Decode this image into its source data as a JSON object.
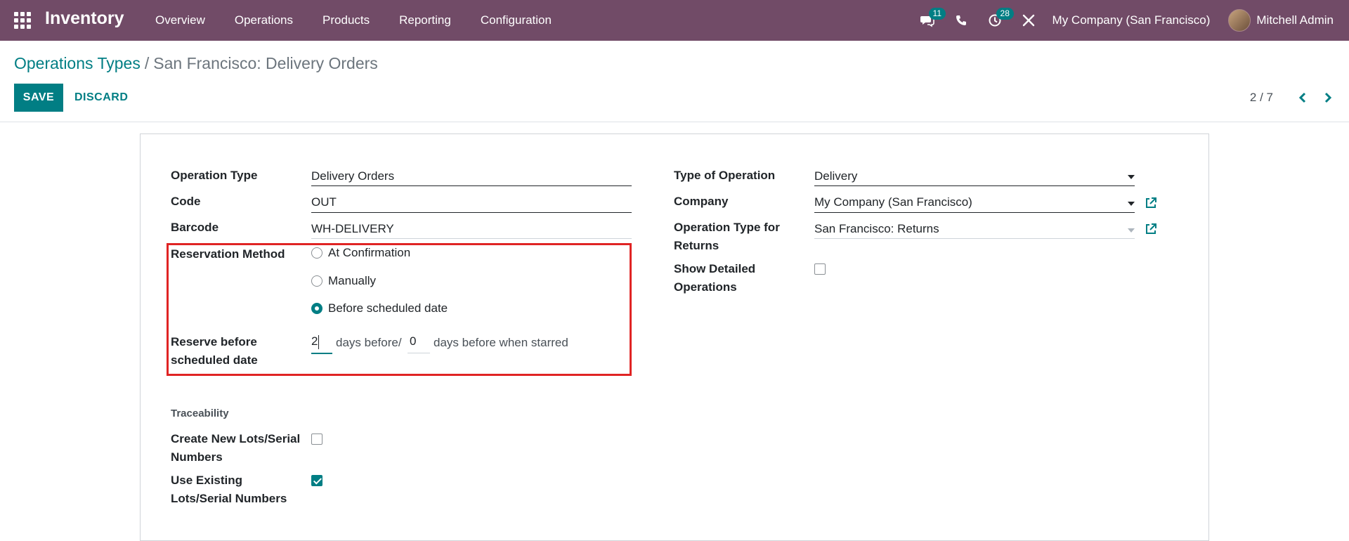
{
  "navbar": {
    "app_title": "Inventory",
    "menu": [
      "Overview",
      "Operations",
      "Products",
      "Reporting",
      "Configuration"
    ],
    "messages_count": "11",
    "activities_count": "28",
    "company": "My Company (San Francisco)",
    "user": "Mitchell Admin",
    "icons": [
      "apps-grid-icon",
      "chat-icon",
      "phone-icon",
      "clock-icon",
      "tools-icon"
    ],
    "background_color": "#714B67"
  },
  "breadcrumb": {
    "parent": "Operations Types",
    "separator": "/",
    "current": "San Francisco: Delivery Orders"
  },
  "actions": {
    "save": "SAVE",
    "discard": "DISCARD"
  },
  "pager": {
    "value": "2 / 7"
  },
  "form": {
    "left": {
      "operation_type_label": "Operation Type",
      "operation_type_value": "Delivery Orders",
      "code_label": "Code",
      "code_value": "OUT",
      "barcode_label": "Barcode",
      "barcode_value": "WH-DELIVERY",
      "reservation_label": "Reservation Method",
      "reservation_options": [
        "At Confirmation",
        "Manually",
        "Before scheduled date"
      ],
      "reservation_selected": "Before scheduled date",
      "reserve_before_label_line1": "Reserve before",
      "reserve_before_label_line2": "scheduled date",
      "reserve_days": "2",
      "reserve_days_suffix": "days before/",
      "reserve_starred_days": "0",
      "reserve_starred_suffix": "days before when starred"
    },
    "right": {
      "type_of_operation_label": "Type of Operation",
      "type_of_operation_value": "Delivery",
      "company_label": "Company",
      "company_value": "My Company (San Francisco)",
      "return_type_label_line1": "Operation Type for",
      "return_type_label_line2": "Returns",
      "return_type_value": "San Francisco: Returns",
      "show_detailed_label_line1": "Show Detailed",
      "show_detailed_label_line2": "Operations",
      "show_detailed_checked": false
    },
    "traceability": {
      "title": "Traceability",
      "create_lots_label_line1": "Create New Lots/Serial",
      "create_lots_label_line2": "Numbers",
      "create_lots_checked": false,
      "use_existing_label_line1": "Use Existing",
      "use_existing_label_line2": "Lots/Serial Numbers",
      "use_existing_checked": true
    }
  },
  "colors": {
    "accent": "#017E84",
    "highlight_border": "#e02424"
  }
}
